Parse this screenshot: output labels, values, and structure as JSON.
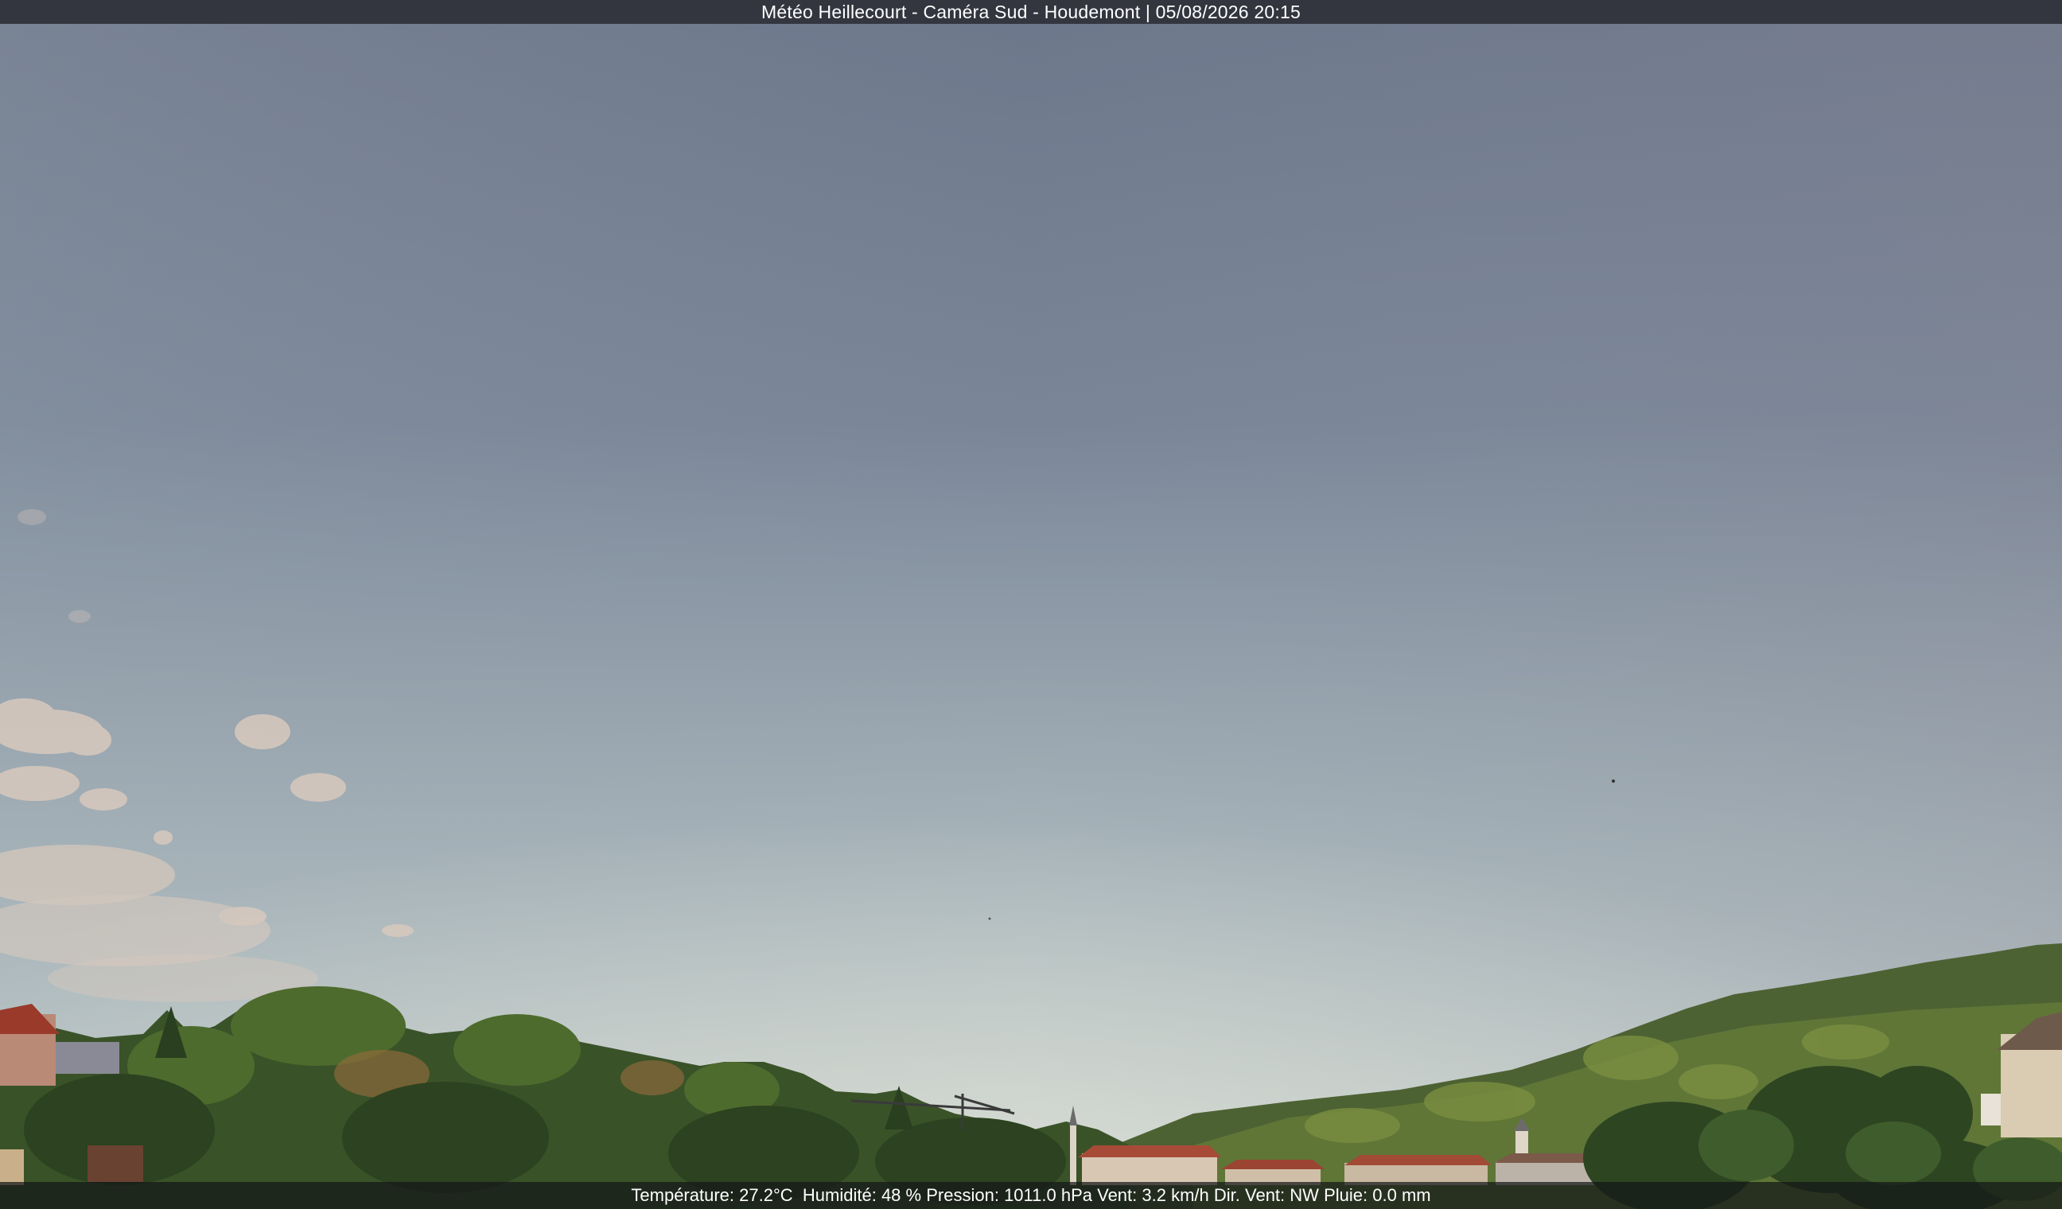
{
  "title": {
    "station": "Météo Heillecourt",
    "camera": "Caméra Sud",
    "location": "Houdemont",
    "datetime": "05/08/2026 20:15",
    "full": "Météo Heillecourt - Caméra Sud - Houdemont | 05/08/2026 20:15"
  },
  "weather": {
    "temperature_label": "Température:",
    "temperature_value": "27.2°C",
    "humidity_label": "Humidité:",
    "humidity_value": "48 %",
    "pressure_label": "Pression:",
    "pressure_value": "1011.0 hPa",
    "wind_label": "Vent:",
    "wind_value": "3.2 km/h",
    "wind_dir_label": "Dir. Vent:",
    "wind_dir_value": "NW",
    "rain_label": "Pluie:",
    "rain_value": "0.0 mm"
  },
  "colors": {
    "sky_top": "#6f7a8e",
    "sky_bottom": "#c7d1cf",
    "title_bar": "#33363f",
    "foliage": "#3d5a2c"
  }
}
